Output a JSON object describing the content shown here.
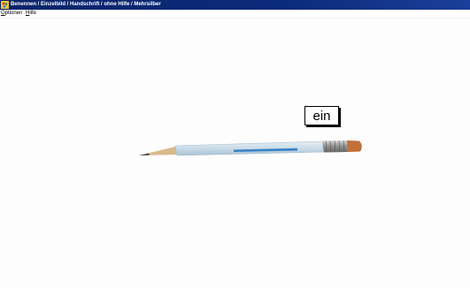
{
  "window": {
    "title": "Benennen / Einzelbild / Handschrift / ohne Hilfe / Mehrsilber",
    "close_label": "",
    "app_icon": "paint-palette-icon"
  },
  "menu": {
    "items": [
      {
        "label": "Optionen"
      },
      {
        "label": "Hilfe"
      }
    ]
  },
  "exercise": {
    "picture": "pencil",
    "word_card": "ein"
  },
  "colors": {
    "titlebar": "#0a246a",
    "pencil_body": "#cfe0ec",
    "pencil_stripe": "#3a82c4",
    "ferrule": "#9a9a9a",
    "eraser": "#c0713a"
  }
}
